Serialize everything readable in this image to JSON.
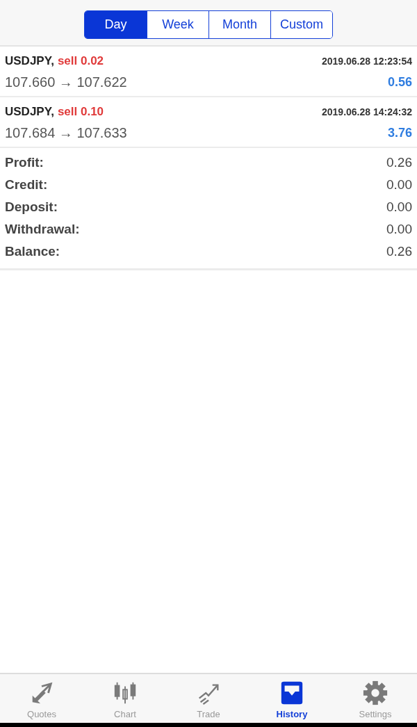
{
  "periods": [
    {
      "label": "Day",
      "selected": true
    },
    {
      "label": "Week",
      "selected": false
    },
    {
      "label": "Month",
      "selected": false
    },
    {
      "label": "Custom",
      "selected": false
    }
  ],
  "deals": [
    {
      "symbol": "USDJPY,",
      "order": "sell 0.02",
      "time": "2019.06.28 12:23:54",
      "prices": "107.660 → 107.622",
      "profit": "0.56"
    },
    {
      "symbol": "USDJPY,",
      "order": "sell 0.10",
      "time": "2019.06.28 14:24:32",
      "prices": "107.684 → 107.633",
      "profit": "3.76"
    }
  ],
  "summary": [
    {
      "label": "Profit:",
      "value": "0.26"
    },
    {
      "label": "Credit:",
      "value": "0.00"
    },
    {
      "label": "Deposit:",
      "value": "0.00"
    },
    {
      "label": "Withdrawal:",
      "value": "0.00"
    },
    {
      "label": "Balance:",
      "value": "0.26"
    }
  ],
  "tab_bar": [
    {
      "kind": "quotes",
      "label": "Quotes",
      "selected": false
    },
    {
      "kind": "chart",
      "label": "Chart",
      "selected": false
    },
    {
      "kind": "trade",
      "label": "Trade",
      "selected": false
    },
    {
      "kind": "history",
      "label": "History",
      "selected": true
    },
    {
      "kind": "settings",
      "label": "Settings",
      "selected": false
    }
  ]
}
